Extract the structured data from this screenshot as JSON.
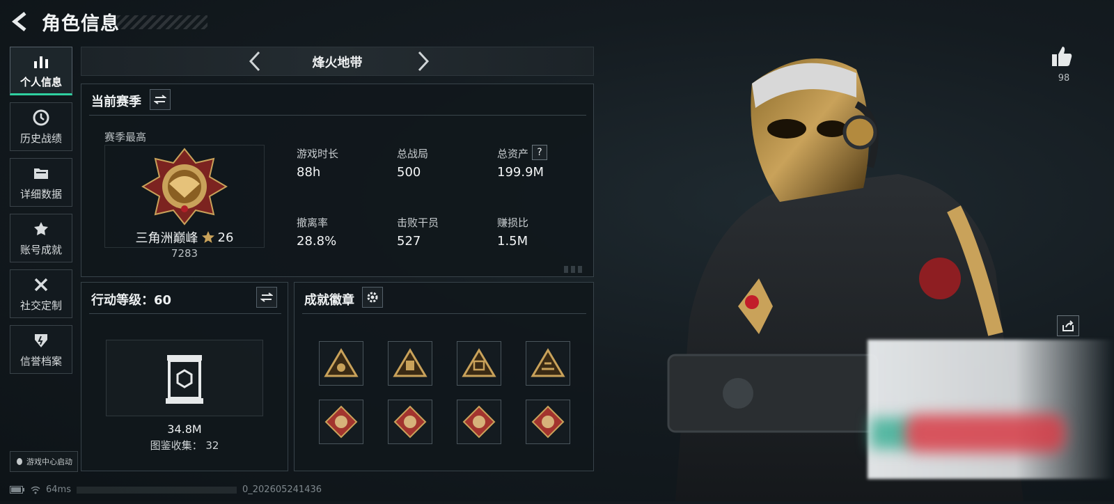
{
  "header": {
    "title": "角色信息"
  },
  "sidebar": {
    "items": [
      {
        "label": "个人信息",
        "icon": "bar-chart-icon",
        "active": true
      },
      {
        "label": "历史战绩",
        "icon": "history-icon",
        "active": false
      },
      {
        "label": "详细数据",
        "icon": "folder-icon",
        "active": false
      },
      {
        "label": "账号成就",
        "icon": "achievement-icon",
        "active": false
      },
      {
        "label": "社交定制",
        "icon": "tools-icon",
        "active": false
      },
      {
        "label": "信誉档案",
        "icon": "credit-shield-icon",
        "active": false
      }
    ],
    "launch_label": "游戏中心启动"
  },
  "mode": {
    "title": "烽火地带"
  },
  "season": {
    "title": "当前赛季",
    "best_label": "赛季最高",
    "rank_name": "三角洲巅峰",
    "rank_stars": "26",
    "rank_points": "7283",
    "stats": [
      {
        "label": "游戏时长",
        "value": "88h"
      },
      {
        "label": "总战局",
        "value": "500"
      },
      {
        "label": "总资产",
        "value": "199.9M",
        "help": "?"
      },
      {
        "label": "撤离率",
        "value": "28.8%"
      },
      {
        "label": "击败干员",
        "value": "527"
      },
      {
        "label": "赚损比",
        "value": "1.5M"
      }
    ]
  },
  "action_level": {
    "title": "行动等级：60",
    "value": "34.8M",
    "collection": "图鉴收集：  32"
  },
  "badges": {
    "title": "成就徽章"
  },
  "right": {
    "likes": "98"
  },
  "statusbar": {
    "ping": "64ms",
    "build": "0_202605241436"
  },
  "colors": {
    "accent": "#2fd0a0",
    "gold": "#c9a25a",
    "badge_red": "#a3342e"
  }
}
